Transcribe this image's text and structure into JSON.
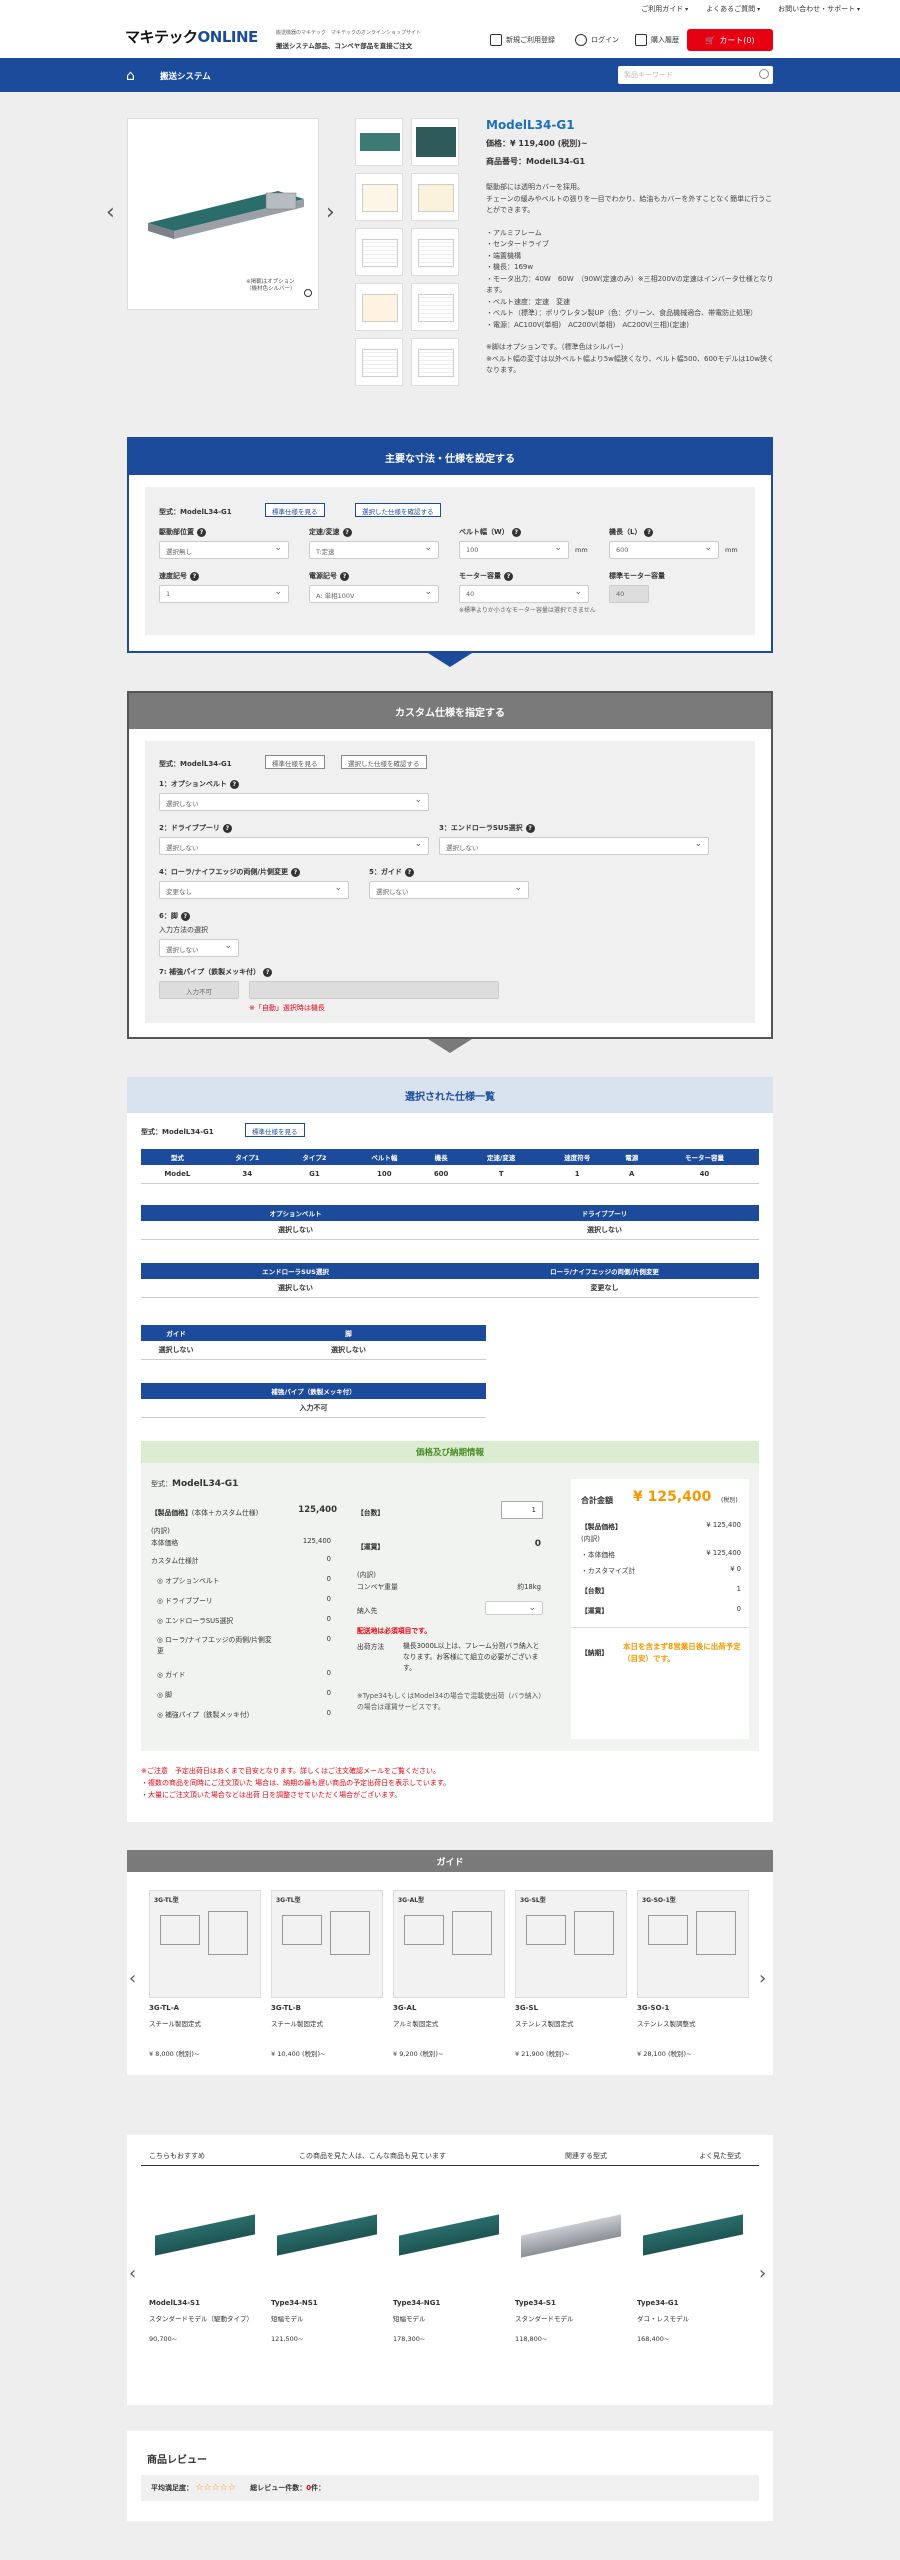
{
  "header": {
    "links": [
      "ご利用ガイド",
      "よくあるご質問",
      "お問い合わせ・サポート"
    ],
    "logo_main": "マキテック",
    "logo_sub": "ONLINE",
    "tagline_small": "搬送機器のマキテック　マキテックのオンラインショップサイト",
    "tagline": "搬送システム部品、コンベヤ部品を直接ご注文",
    "register": "新規ご利用登録",
    "login": "ログイン",
    "history": "購入履歴",
    "cart": "カート(0)"
  },
  "nav": {
    "title": "搬送システム",
    "search_placeholder": "製品キーワード"
  },
  "product": {
    "name": "ModelL34-G1",
    "price": "価格：¥ 119,400 (税別)~",
    "number": "商品番号：ModelL34-G1",
    "image_caption": "※掲載はオプション\n（機材色シルバー）",
    "description": [
      "駆動部には透明カバーを採用。",
      "チェーンの緩みやベルトの張りを一目でわかり、給油もカバーを外すことなく簡単に行うことができます。",
      "",
      "・アルミフレーム",
      "・センタードライブ",
      "・端置機構",
      "・機長：169w",
      "・モータ出力：40W　60W　（90W(定速のみ）※三相200Vの定速はインバータ仕様となります。",
      "・ベルト速度：定速　変速",
      "・ベルト（標準）：ポリウレタン製UP（色：グリーン、食品機械適合、帯電防止処理）",
      "・電源：AC100V(単相)　AC200V(単相)　AC200V(三相)(定速)",
      "",
      "※脚はオプションです。（標準色はシルバー）",
      "※ベルト幅の変寸は以外ベルト幅より5w幅狭くなり、ベルト幅500、600モデルは10w狭くなります。"
    ]
  },
  "spec": {
    "title": "主要な寸法・仕様を設定する",
    "model_label": "型式：",
    "model": "ModelL34-G1",
    "btn_std": "標準仕様を見る",
    "btn_confirm": "選択した仕様を確認する",
    "fields": [
      {
        "label": "駆動部位置",
        "value": "選択無し"
      },
      {
        "label": "定速/変速",
        "value": "T:定速"
      },
      {
        "label": "ベルト幅（W）",
        "value": "100",
        "unit": "mm"
      },
      {
        "label": "機長（L）",
        "value": "600",
        "unit": "mm"
      },
      {
        "label": "速度記号",
        "value": "1"
      },
      {
        "label": "電源記号",
        "value": "A: 単相100V"
      },
      {
        "label": "モーター容量",
        "value": "40"
      },
      {
        "label": "標準モーター容量",
        "value": "40"
      }
    ],
    "motor_note": "※標準よりか小さなモーター容量は選択できません"
  },
  "custom": {
    "title": "カスタム仕様を指定する",
    "model_label": "型式：",
    "model": "ModelL34-G1",
    "btn_std": "標準仕様を見る",
    "btn_confirm": "選択した仕様を確認する",
    "f1": {
      "label": "1：オプションベルト",
      "value": "選択しない"
    },
    "f2": {
      "label": "2：ドライブプーリ",
      "value": "選択しない"
    },
    "f3": {
      "label": "3：エンドローラSUS選択",
      "value": "選択しない"
    },
    "f4": {
      "label": "4：ローラ/ナイフエッジの両側/片側変更",
      "value": "変更なし"
    },
    "f5": {
      "label": "5：ガイド",
      "value": "選択しない"
    },
    "f6": {
      "label": "6：脚",
      "sub": "入力方法の選択",
      "value": "選択しない"
    },
    "f7": {
      "label": "7: 補強パイプ（鉄製メッキ付）",
      "btn": "入力不可",
      "note": "※「自動」選択時は機長"
    }
  },
  "selected": {
    "title": "選択された仕様一覧",
    "model_label": "型式：",
    "model": "ModelL34-G1",
    "btn_std": "標準仕様を見る",
    "table_headers": [
      "型式",
      "タイプ1",
      "タイプ2",
      "ベルト幅",
      "機長",
      "定速/変速",
      "速度符号",
      "電源",
      "モーター容量"
    ],
    "table_values": [
      "ModeL",
      "34",
      "G1",
      "100",
      "600",
      "T",
      "1",
      "A",
      "40"
    ],
    "opt_h": [
      "オプションベルト",
      "ドライブプーリ"
    ],
    "opt_v": [
      "選択しない",
      "選択しない"
    ],
    "end_h": [
      "エンドローラSUS選択",
      "ローラ/ナイフエッジの両側/片側変更"
    ],
    "end_v": [
      "選択しない",
      "変更なし"
    ],
    "guide_h": [
      "ガイド",
      "脚"
    ],
    "guide_v": [
      "選択しない",
      "選択しない"
    ],
    "pipe_h": "補強パイプ（鉄製メッキ付）",
    "pipe_v": "入力不可"
  },
  "pricing": {
    "title": "価格及び納期情報",
    "model_label": "型式：",
    "model": "ModelL34-G1",
    "product_price_label": "【製品価格】",
    "product_price_note": "(本体＋カスタム仕様)",
    "product_price": "125,400",
    "breakdown": "(内訳)",
    "body_price_label": "本体価格",
    "body_price": "125,400",
    "custom_total_label": "カスタム仕様計",
    "custom_total": "0",
    "items": [
      {
        "label": "◎ オプションベルト",
        "value": "0"
      },
      {
        "label": "◎ ドライブプーリ",
        "value": "0"
      },
      {
        "label": "◎ エンドローラSUS選択",
        "value": "0"
      },
      {
        "label": "◎ ローラ/ナイフエッジの両側/片側変更",
        "value": "0"
      },
      {
        "label": "◎ ガイド",
        "value": "0"
      },
      {
        "label": "◎ 脚",
        "value": "0"
      },
      {
        "label": "◎ 補強パイプ（鉄製メッキ付）",
        "value": "0"
      }
    ],
    "qty_label": "【台数】",
    "qty": "1",
    "ship_label": "【運賃】",
    "ship": "0",
    "weight_breakdown": "(内訳)",
    "weight_label": "コンベヤ重量",
    "weight": "約18kg",
    "dest_label": "納入先",
    "dest_note": "配送地は必須項目です。",
    "ship_method_label": "出荷方法",
    "ship_method": "機長3000L以上は、フレーム分割バラ納入となります。お客様にて組立の必要がございます。",
    "type_note": "※Type34もしくはModel34の場合で混載使出荷（バラ納入）の場合は運賃サービスです。",
    "total_label": "合計金額",
    "total": "¥ 125,400",
    "total_tax": "(税別)",
    "r_product_label": "【製品価格】",
    "r_product": "¥ 125,400",
    "r_breakdown": "(内訳)",
    "r_body_label": "・本体価格",
    "r_body": "¥ 125,400",
    "r_custom_label": "・カスタマイズ計",
    "r_custom": "¥ 0",
    "r_qty_label": "【台数】",
    "r_qty": "1",
    "r_ship_label": "【運賃】",
    "r_ship": "0",
    "delivery_label": "【納期】",
    "delivery": "本日を含まず8営業日後に出荷予定（目安）です。"
  },
  "notes": [
    "※ご注意　予定出荷日はあくまで目安となります。詳しくはご注文確認メールをご覧ください。",
    "・複数の商品を同時にご注文頂いた 場合は、納期の最も遅い商品の予定出荷日を表示しています。",
    "・大量にご注文頂いた場合などは出荷 日を調整させていただく場合がございます。"
  ],
  "guide": {
    "title": "ガイド",
    "cards": [
      {
        "tag": "3G-TL型",
        "name": "3G-TL-A",
        "sub": "スチール製固定式",
        "price": "¥ 8,000 (税別)~"
      },
      {
        "tag": "3G-TL型",
        "name": "3G-TL-B",
        "sub": "スチール製固定式",
        "price": "¥ 10,400 (税別)~"
      },
      {
        "tag": "3G-AL型",
        "name": "3G-AL",
        "sub": "アルミ製固定式",
        "price": "¥ 9,200 (税別)~"
      },
      {
        "tag": "3G-SL型",
        "name": "3G-SL",
        "sub": "ステンレス製固定式",
        "price": "¥ 21,900 (税別)~"
      },
      {
        "tag": "3G-SO-1型",
        "name": "3G-SO-1",
        "sub": "ステンレス製調整式",
        "price": "¥ 28,100 (税別)~"
      }
    ]
  },
  "recommend": {
    "tabs": [
      "こちらもおすすめ",
      "この商品を見た人は、こんな商品も見ています",
      "関連する型式",
      "よく見た型式"
    ],
    "cards": [
      {
        "name": "ModelL34-S1",
        "sub": "スタンダードモデル（駆動タイプ）",
        "price": "90,700~"
      },
      {
        "name": "Type34-NS1",
        "sub": "短幅モデル",
        "price": "121,500~"
      },
      {
        "name": "Type34-NG1",
        "sub": "短幅モデル",
        "price": "178,300~"
      },
      {
        "name": "Type34-S1",
        "sub": "スタンダードモデル",
        "price": "118,800~"
      },
      {
        "name": "Type34-G1",
        "sub": "ダコ・レスモデル",
        "price": "168,400~"
      }
    ]
  },
  "review": {
    "title": "商品レビュー",
    "avg_label": "平均満足度：",
    "count_label": "総レビュー件数：",
    "count": "0",
    "count_unit": "件："
  },
  "colors": {
    "brand": "#1d4b9b",
    "accent": "#e60012",
    "price": "#f39800",
    "gray_header": "#7a7a7a"
  }
}
